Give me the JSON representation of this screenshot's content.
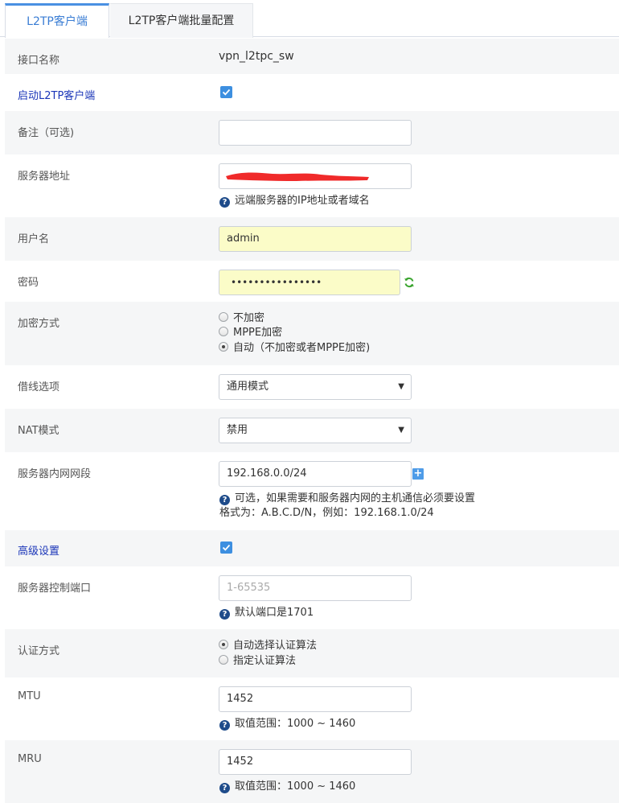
{
  "tabs": [
    {
      "label": "L2TP客户端",
      "active": true
    },
    {
      "label": "L2TP客户端批量配置",
      "active": false
    }
  ],
  "fields": {
    "iface_name": {
      "label": "接口名称",
      "value": "vpn_l2tpc_sw"
    },
    "enable": {
      "label": "启动L2TP客户端",
      "checked": true
    },
    "remark": {
      "label": "备注（可选)",
      "value": ""
    },
    "server_addr": {
      "label": "服务器地址",
      "hint": "远端服务器的IP地址或者域名"
    },
    "username": {
      "label": "用户名",
      "value": "admin"
    },
    "password": {
      "label": "密码",
      "value": "••••••••••••••••"
    },
    "encryption": {
      "label": "加密方式",
      "options": [
        "不加密",
        "MPPE加密",
        "自动（不加密或者MPPE加密)"
      ],
      "selected": 2
    },
    "line_option": {
      "label": "借线选项",
      "value": "通用模式"
    },
    "nat_mode": {
      "label": "NAT模式",
      "value": "禁用"
    },
    "server_lan": {
      "label": "服务器内网网段",
      "value": "192.168.0.0/24",
      "hint": "可选，如果需要和服务器内网的主机通信必须要设置",
      "hint2": "格式为：A.B.C.D/N，例如：192.168.1.0/24"
    },
    "advanced": {
      "label": "高级设置",
      "checked": true
    },
    "control_port": {
      "label": "服务器控制端口",
      "placeholder": "1-65535",
      "hint": "默认端口是1701"
    },
    "auth_method": {
      "label": "认证方式",
      "options": [
        "自动选择认证算法",
        "指定认证算法"
      ],
      "selected": 0
    },
    "mtu": {
      "label": "MTU",
      "value": "1452",
      "hint": "取值范围：1000 ~ 1460"
    },
    "mru": {
      "label": "MRU",
      "value": "1452",
      "hint": "取值范围：1000 ~ 1460"
    }
  },
  "colors": {
    "accent": "#4a90e2",
    "label_blue": "#1a35b8",
    "autofill": "#fbfcc8",
    "redaction": "#f02a2a"
  }
}
